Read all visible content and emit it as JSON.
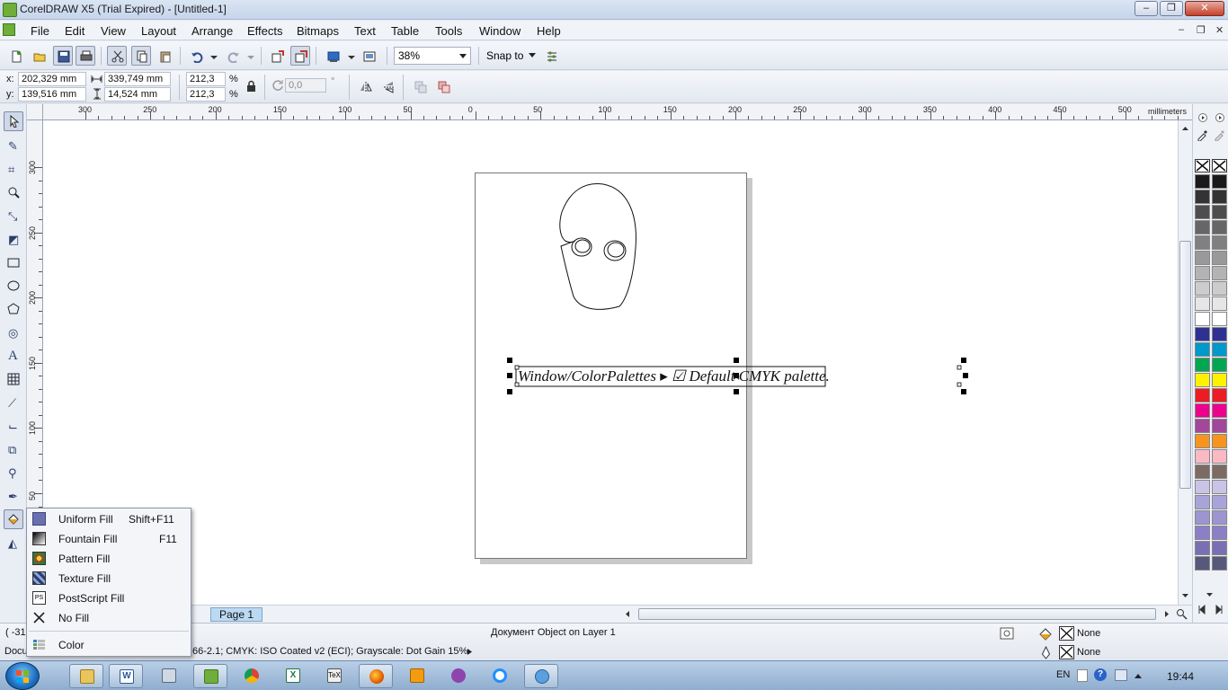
{
  "window": {
    "title": "CorelDRAW X5 (Trial Expired) - [Untitled-1]",
    "minimize": "–",
    "restore": "❐",
    "close": "✕"
  },
  "menubar": {
    "items": [
      "File",
      "Edit",
      "View",
      "Layout",
      "Arrange",
      "Effects",
      "Bitmaps",
      "Text",
      "Table",
      "Tools",
      "Window",
      "Help"
    ],
    "doc_min": "–",
    "doc_restore": "❐",
    "doc_close": "✕"
  },
  "std_toolbar": {
    "zoom": "38%",
    "snap_to": "Snap to"
  },
  "property_bar": {
    "x_label": "x:",
    "x_value": "202,329 mm",
    "y_label": "y:",
    "y_value": "139,516 mm",
    "width_value": "339,749 mm",
    "height_value": "14,524 mm",
    "scale_x": "212,3",
    "scale_y": "212,3",
    "percent": "%",
    "angle_value": "0,0",
    "degree": "°"
  },
  "rulers": {
    "unit": "millimeters",
    "top_labels": [
      "300",
      "250",
      "200",
      "150",
      "100",
      "50",
      "0",
      "50",
      "100",
      "150",
      "200",
      "250",
      "300",
      "350",
      "400",
      "450",
      "500"
    ],
    "left_labels": [
      "300",
      "250",
      "200",
      "150",
      "100",
      "50"
    ]
  },
  "canvas": {
    "text_object": "Window/ColorPalettes ▸ ☑ Default CMYK palette."
  },
  "page_tabs": {
    "page1": "Page 1"
  },
  "palette": {
    "swatches": [
      "#1a1a1a",
      "#333333",
      "#4d4d4d",
      "#666666",
      "#808080",
      "#999999",
      "#b3b3b3",
      "#cccccc",
      "#e6e6e6",
      "#ffffff",
      "#2e3192",
      "#0099cc",
      "#00a651",
      "#fff200",
      "#ed1c24",
      "#ec008c",
      "#a3479a",
      "#f7941d",
      "#fbb9c4",
      "#7d6b63",
      "#c9c4e6",
      "#a8a4d9",
      "#9c95d1",
      "#8d7fc7",
      "#7a6fb5",
      "#56597a"
    ]
  },
  "status": {
    "coords": "( -31",
    "doc_label": "Docu",
    "object_info": "Документ Object on Layer 1",
    "color_profile": "66-2.1; CMYK: ISO Coated v2 (ECI); Grayscale: Dot Gain 15%",
    "fill_value": "None",
    "outline_value": "None"
  },
  "fill_flyout": {
    "items": [
      {
        "label": "Uniform Fill",
        "shortcut": "Shift+F11"
      },
      {
        "label": "Fountain Fill",
        "shortcut": "F11"
      },
      {
        "label": "Pattern Fill",
        "shortcut": ""
      },
      {
        "label": "Texture Fill",
        "shortcut": ""
      },
      {
        "label": "PostScript Fill",
        "shortcut": ""
      },
      {
        "label": "No Fill",
        "shortcut": ""
      },
      {
        "label": "Color",
        "shortcut": ""
      }
    ]
  },
  "taskbar": {
    "language": "EN",
    "clock": "19:44"
  }
}
